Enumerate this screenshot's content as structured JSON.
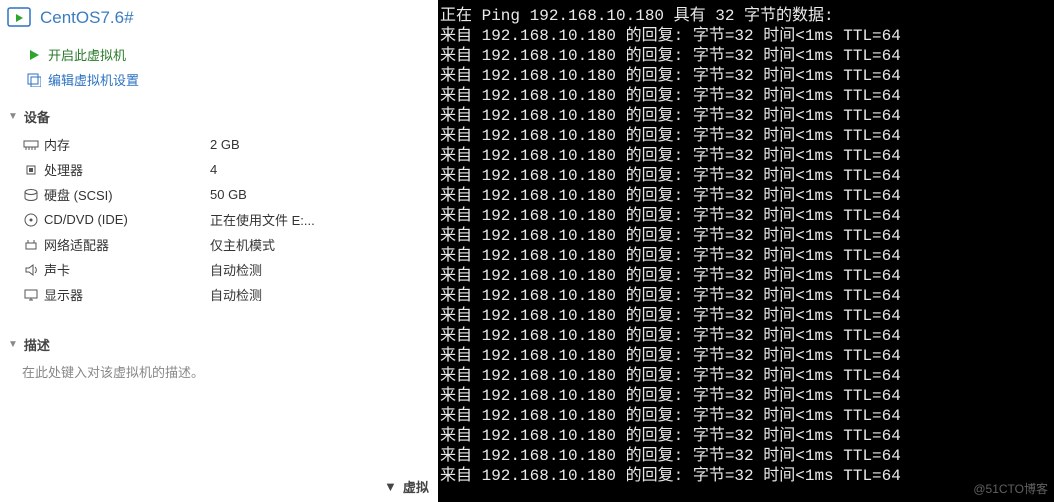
{
  "header": {
    "vm_title": "CentOS7.6#"
  },
  "actions": {
    "power_on": "开启此虚拟机",
    "edit_settings": "编辑虚拟机设置"
  },
  "sections": {
    "devices_label": "设备",
    "description_label": "描述",
    "vmdetails_label": "虚拟"
  },
  "devices": [
    {
      "icon": "memory",
      "label": "内存",
      "value": "2 GB"
    },
    {
      "icon": "cpu",
      "label": "处理器",
      "value": "4"
    },
    {
      "icon": "disk",
      "label": "硬盘 (SCSI)",
      "value": "50 GB"
    },
    {
      "icon": "cd",
      "label": "CD/DVD (IDE)",
      "value": "正在使用文件 E:..."
    },
    {
      "icon": "net",
      "label": "网络适配器",
      "value": "仅主机模式"
    },
    {
      "icon": "sound",
      "label": "声卡",
      "value": "自动检测"
    },
    {
      "icon": "display",
      "label": "显示器",
      "value": "自动检测"
    }
  ],
  "description": {
    "placeholder": "在此处键入对该虚拟机的描述。"
  },
  "terminal": {
    "header": "正在 Ping 192.168.10.180 具有 32 字节的数据:",
    "reply": "来自 192.168.10.180 的回复: 字节=32 时间<1ms TTL=64",
    "reply_count": 23
  },
  "watermark": "@51CTO博客"
}
